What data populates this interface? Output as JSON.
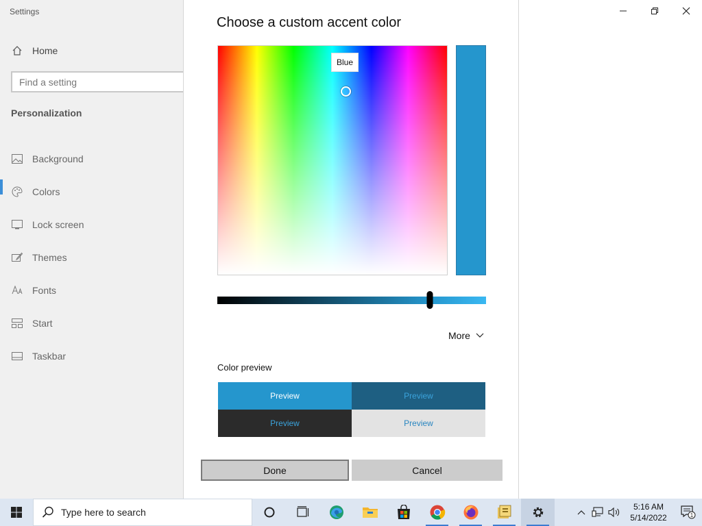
{
  "app": {
    "title": "Settings"
  },
  "sidebar": {
    "home_label": "Home",
    "search_placeholder": "Find a setting",
    "section_title": "Personalization",
    "items": [
      {
        "label": "Background",
        "icon": "image-icon"
      },
      {
        "label": "Colors",
        "icon": "palette-icon"
      },
      {
        "label": "Lock screen",
        "icon": "lock-screen-icon"
      },
      {
        "label": "Themes",
        "icon": "brush-icon"
      },
      {
        "label": "Fonts",
        "icon": "fonts-icon"
      },
      {
        "label": "Start",
        "icon": "start-layout-icon"
      },
      {
        "label": "Taskbar",
        "icon": "taskbar-icon"
      }
    ],
    "active_item": "Colors"
  },
  "dialog": {
    "title": "Choose a custom accent color",
    "tooltip": "Blue",
    "selected_color": "#2596cd",
    "brightness_value": 0.79,
    "more_label": "More",
    "preview_label": "Color preview",
    "previews": [
      {
        "text": "Preview",
        "bg": "#2596cd",
        "fg": "#ffffff"
      },
      {
        "text": "Preview",
        "bg": "#1e5f82",
        "fg": "#3ba3dc"
      },
      {
        "text": "Preview",
        "bg": "#2b2b2b",
        "fg": "#3ba3dc"
      },
      {
        "text": "Preview",
        "bg": "#e3e3e3",
        "fg": "#2a86c0"
      }
    ],
    "done_label": "Done",
    "cancel_label": "Cancel"
  },
  "taskbar": {
    "search_text": "Type here to search",
    "time": "5:16 AM",
    "date": "5/14/2022",
    "notification_count": "1"
  }
}
